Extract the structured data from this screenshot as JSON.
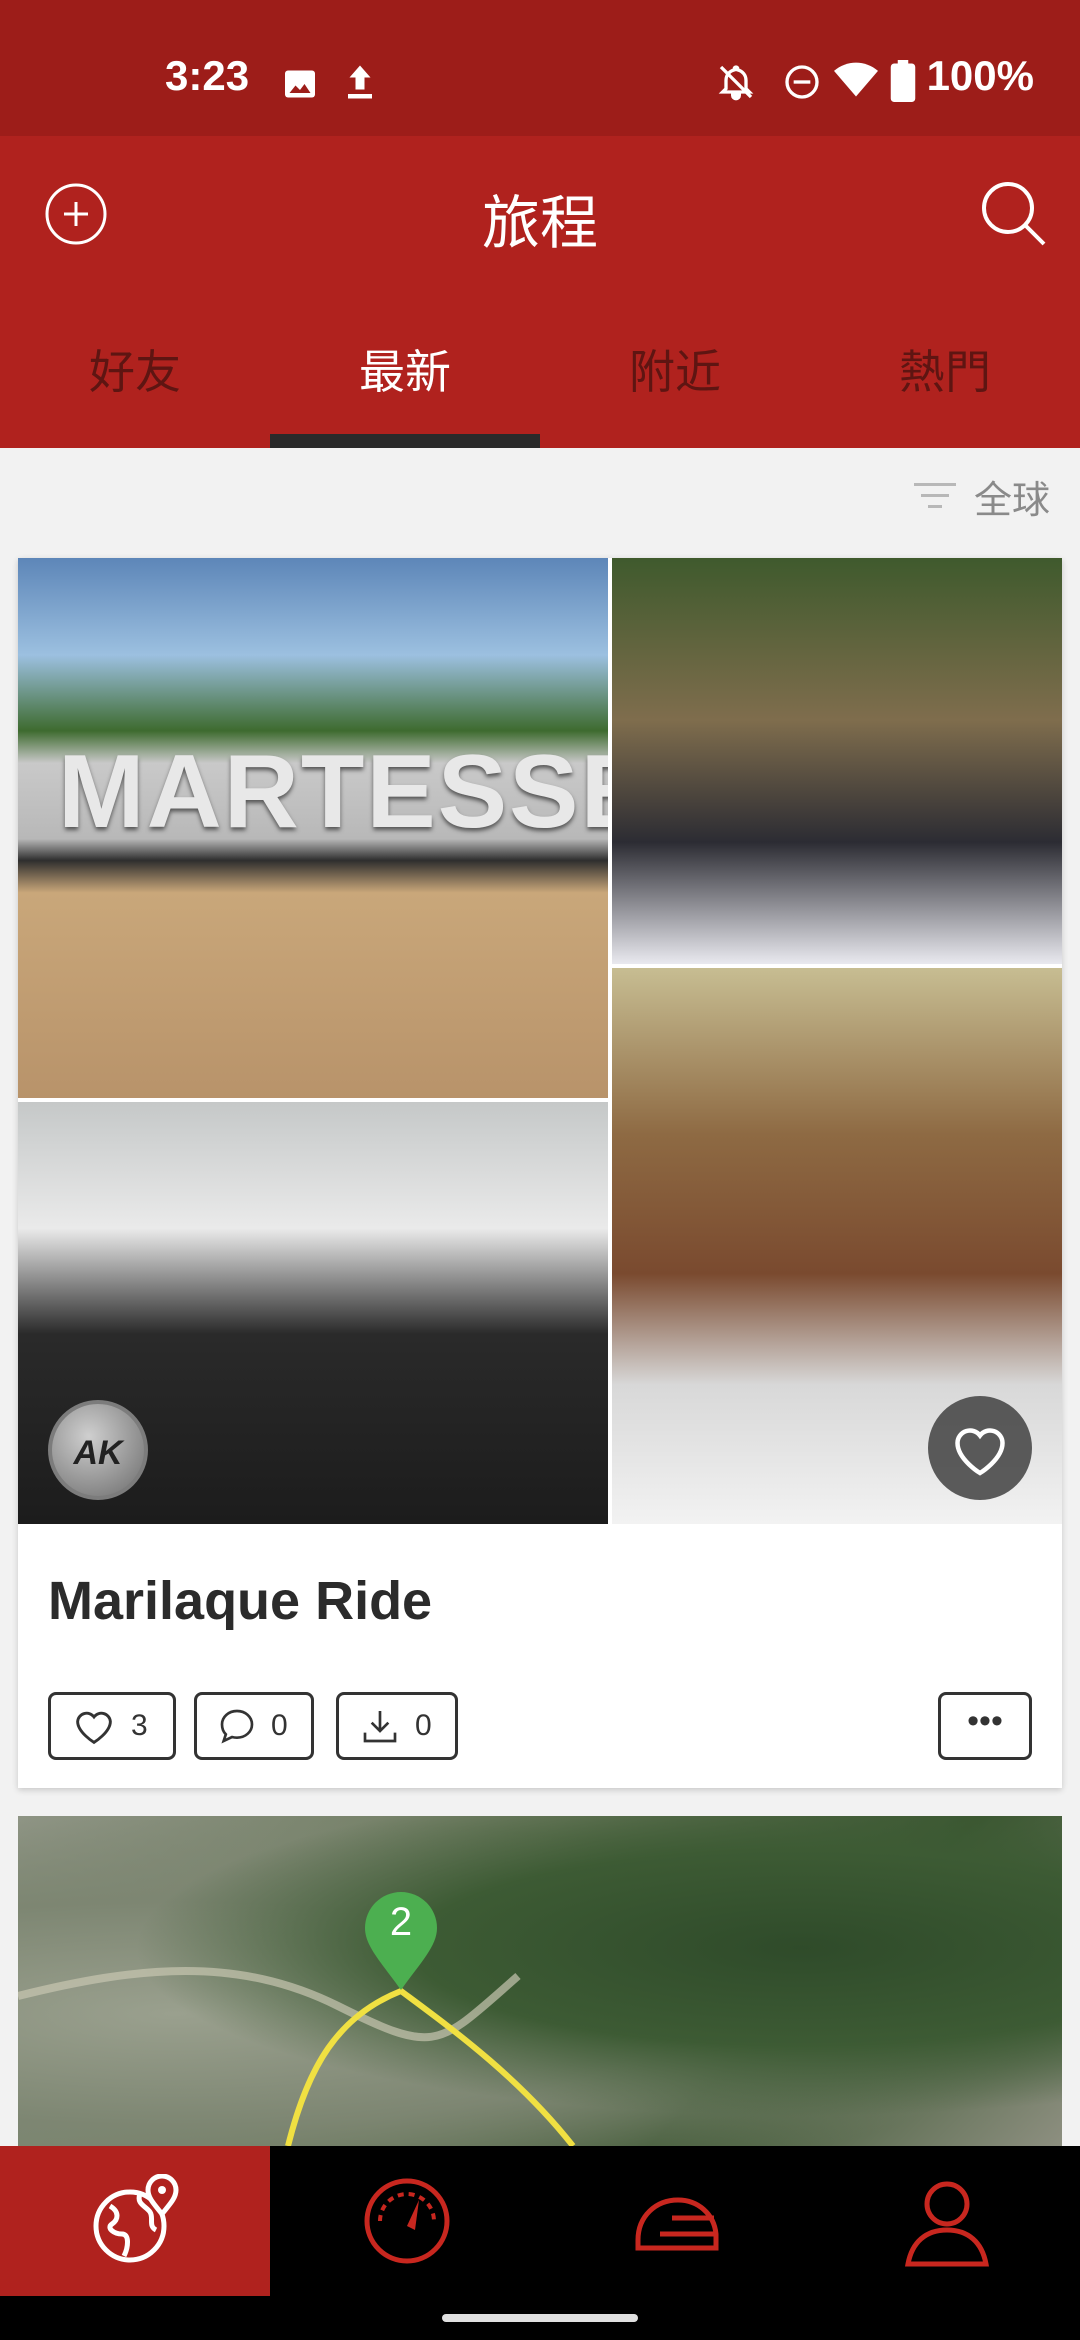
{
  "status_bar": {
    "time": "3:23",
    "battery": "100%",
    "icons": [
      "image-icon",
      "upload-icon",
      "bell-off-icon",
      "dnd-icon",
      "wifi-icon",
      "battery-icon"
    ]
  },
  "app_bar": {
    "title": "旅程",
    "add_icon": "add-circle-icon",
    "search_icon": "search-icon"
  },
  "tabs": [
    {
      "label": "好友",
      "active": false
    },
    {
      "label": "最新",
      "active": true
    },
    {
      "label": "附近",
      "active": false
    },
    {
      "label": "熱門",
      "active": false
    }
  ],
  "filter": {
    "label": "全球",
    "icon": "filter-icon"
  },
  "trip_card": {
    "title": "Marilaque Ride",
    "photo_sign_text": "MARTESSEM",
    "avatar_text": "AK",
    "likes": "3",
    "comments": "0",
    "downloads": "0",
    "more_label": "•••"
  },
  "map_card": {
    "marker_label": "2"
  },
  "bottom_nav": [
    {
      "name": "trips",
      "icon": "globe-pin-icon",
      "active": true
    },
    {
      "name": "dashboard",
      "icon": "speedometer-icon",
      "active": false
    },
    {
      "name": "garage",
      "icon": "helmet-icon",
      "active": false
    },
    {
      "name": "profile",
      "icon": "person-icon",
      "active": false
    }
  ],
  "colors": {
    "primary": "#b0221e",
    "status_bar": "#9d1d19",
    "route": "#f0e042",
    "marker": "#4caf50"
  }
}
